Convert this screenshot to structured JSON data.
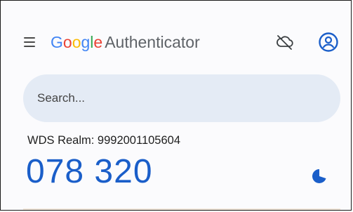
{
  "header": {
    "brand_letters": [
      {
        "char": "G",
        "color": "#4285F4"
      },
      {
        "char": "o",
        "color": "#EA4335"
      },
      {
        "char": "o",
        "color": "#FBBC05"
      },
      {
        "char": "g",
        "color": "#4285F4"
      },
      {
        "char": "l",
        "color": "#34A853"
      },
      {
        "char": "e",
        "color": "#EA4335"
      }
    ],
    "product_name": "Authenticator",
    "menu_icon": "menu-icon",
    "sync_icon": "cloud-off-icon",
    "account_icon": "account-circle-icon"
  },
  "search": {
    "placeholder": "Search..."
  },
  "accounts": [
    {
      "name": "WDS Realm: 9992001105604",
      "code": "078 320",
      "timer_icon": "countdown-timer-icon",
      "timer_remaining_fraction": 0.7
    }
  ],
  "colors": {
    "code": "#1a5ec9",
    "search_bg": "#e4ebf5",
    "account_icon": "#1a5ec9"
  }
}
